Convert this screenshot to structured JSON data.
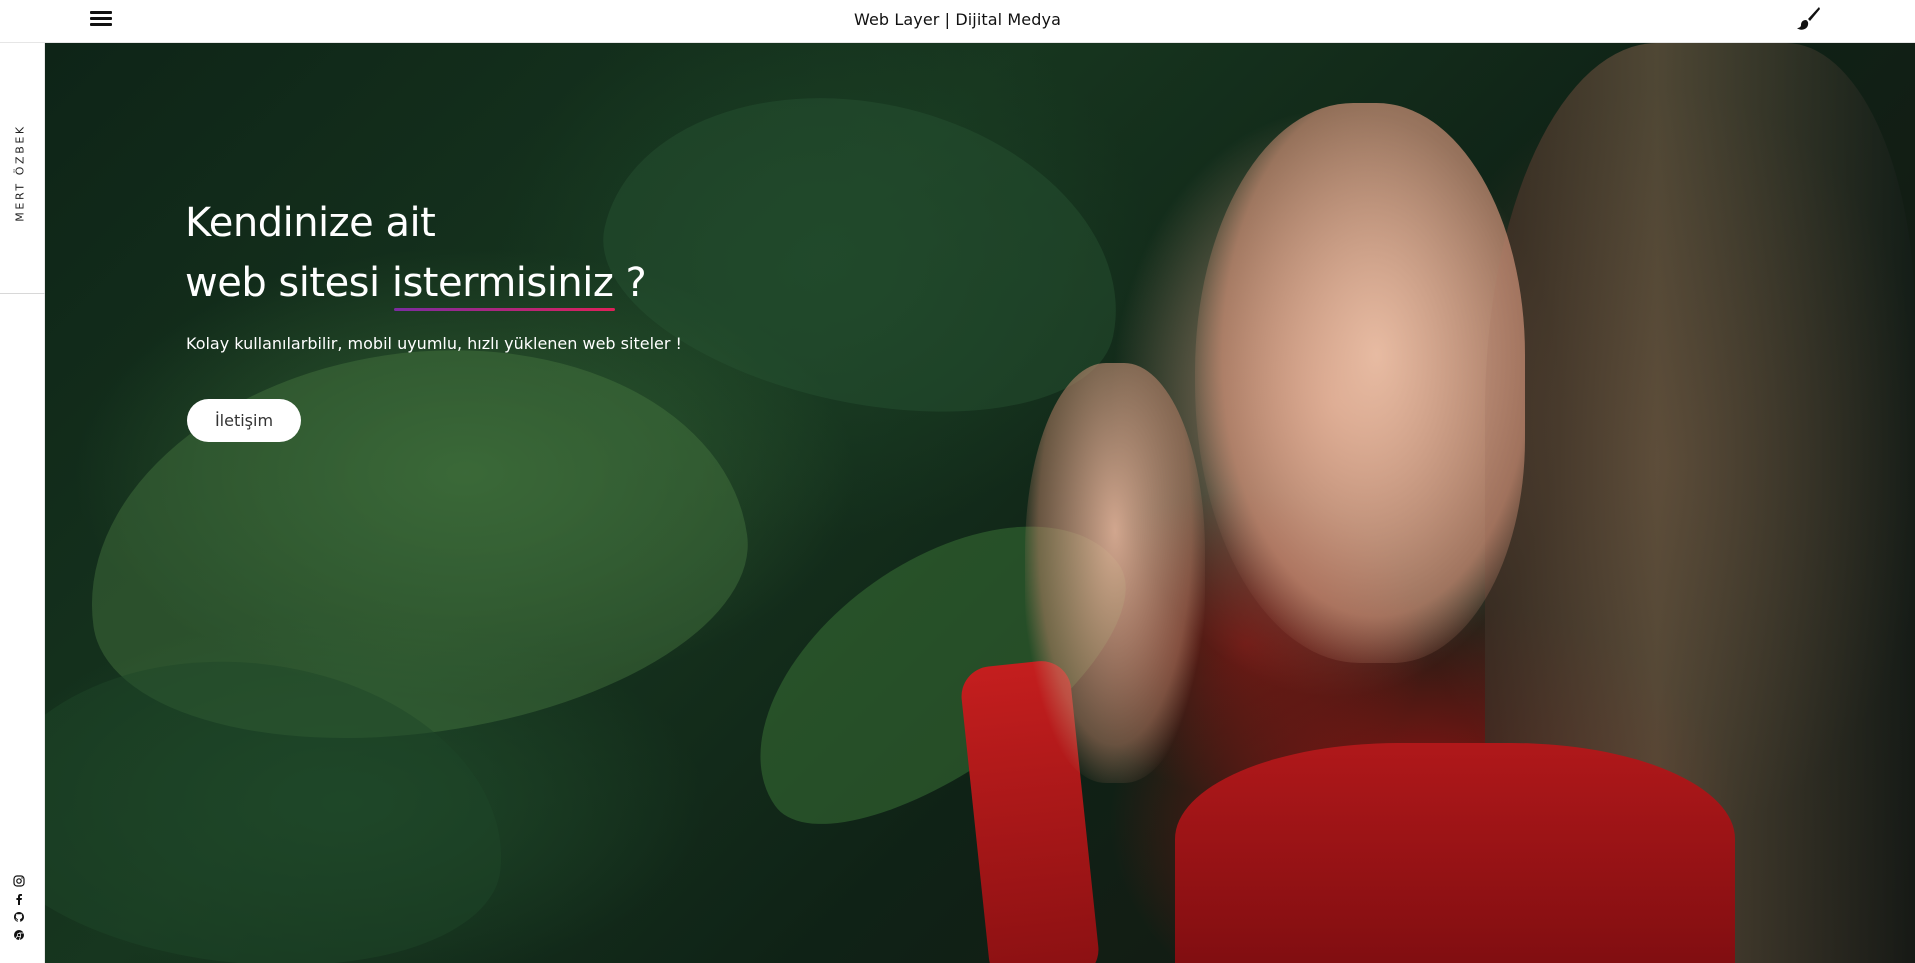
{
  "header": {
    "title": "Web Layer | Dijital Medya",
    "menu_icon": "hamburger-menu-icon",
    "theme_icon": "paint-brush-icon"
  },
  "sidebar": {
    "name": "MERT ÖZBEK",
    "social": [
      "instagram-icon",
      "facebook-icon",
      "github-icon",
      "chrome-icon"
    ]
  },
  "hero": {
    "title_line1": "Kendinize ait",
    "title_line2_prefix": "web sitesi ",
    "title_highlight": "istermisiniz",
    "title_suffix": " ?",
    "subtitle": "Kolay kullanılarbilir, mobil uyumlu, hızlı yüklenen web siteler !",
    "cta_label": "İletişim",
    "underline_colors": [
      "#7b2ca0",
      "#e0215a"
    ]
  }
}
